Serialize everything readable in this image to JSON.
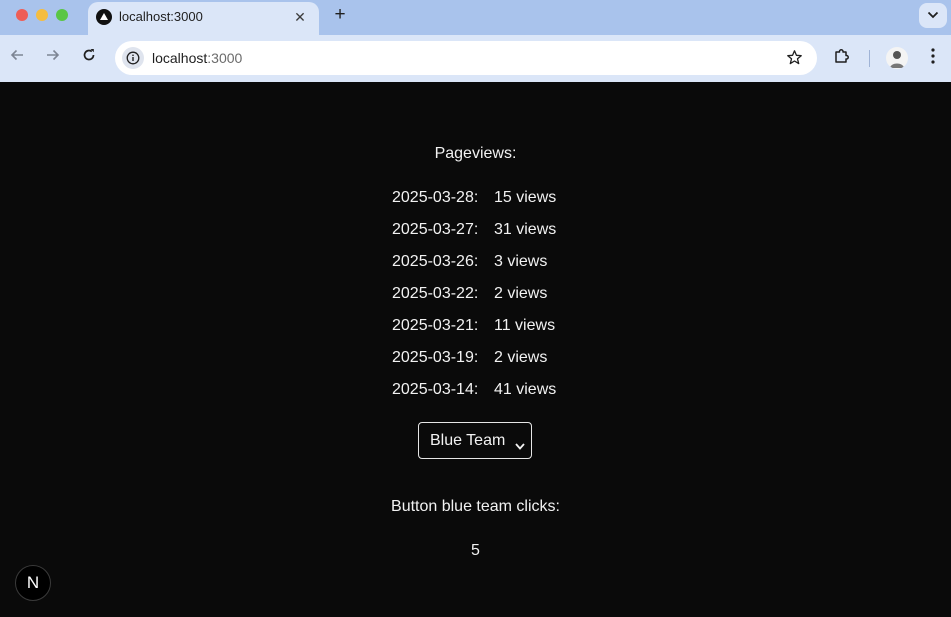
{
  "browser": {
    "tab": {
      "title": "localhost:3000",
      "favicon": "vercel-triangle-icon"
    },
    "url": {
      "host": "localhost",
      "port": ":3000"
    },
    "colors": {
      "tabstrip": "#a9c3ec",
      "toolbar": "#dbe6f8"
    }
  },
  "page": {
    "heading": "Pageviews:",
    "pageviews": [
      {
        "date": "2025-03-28:",
        "views": "15 views"
      },
      {
        "date": "2025-03-27:",
        "views": "31 views"
      },
      {
        "date": "2025-03-26:",
        "views": "3 views"
      },
      {
        "date": "2025-03-22:",
        "views": "2 views"
      },
      {
        "date": "2025-03-21:",
        "views": "11 views"
      },
      {
        "date": "2025-03-19:",
        "views": "2 views"
      },
      {
        "date": "2025-03-14:",
        "views": "41 views"
      }
    ],
    "team_select": {
      "selected": "Blue Team"
    },
    "clicks_label": "Button blue team clicks:",
    "clicks_value": "5",
    "dev_badge": "N",
    "colors": {
      "background": "#0a0a0a",
      "text": "#f2f2f2"
    }
  }
}
